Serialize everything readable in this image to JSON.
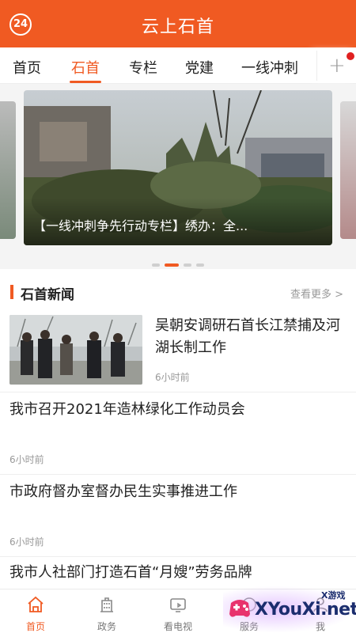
{
  "header": {
    "badge": "24",
    "title": "云上石首"
  },
  "tabs": [
    {
      "label": "首页",
      "active": false
    },
    {
      "label": "石首",
      "active": true
    },
    {
      "label": "专栏",
      "active": false
    },
    {
      "label": "党建",
      "active": false
    },
    {
      "label": "一线冲刺",
      "active": false
    }
  ],
  "tabs_add_icon": "plus-icon",
  "carousel": {
    "caption": "【一线冲刺争先行动专栏】绣办：全...",
    "slide_count": 4,
    "active_index": 1
  },
  "section": {
    "title": "石首新闻",
    "more": "查看更多 >"
  },
  "news": [
    {
      "title": "吴朝安调研石首长江禁捕及河湖长制工作",
      "time": "6小时前",
      "has_image": true
    },
    {
      "title": "我市召开2021年造林绿化工作动员会",
      "time": "6小时前",
      "has_image": false
    },
    {
      "title": "市政府督办室督办民生实事推进工作",
      "time": "6小时前",
      "has_image": false
    },
    {
      "title": "我市人社部门打造石首“月嫂”劳务品牌",
      "time": "",
      "has_image": false
    }
  ],
  "bottom_nav": [
    {
      "label": "首页",
      "icon": "home-icon",
      "active": true
    },
    {
      "label": "政务",
      "icon": "building-icon",
      "active": false
    },
    {
      "label": "看电视",
      "icon": "tv-icon",
      "active": false
    },
    {
      "label": "服务",
      "icon": "service-icon",
      "active": false
    },
    {
      "label": "我",
      "icon": "user-icon",
      "active": false
    }
  ],
  "watermark": {
    "main": "XYouXi.net",
    "small": "X游戏"
  },
  "colors": {
    "accent": "#f05a22"
  }
}
